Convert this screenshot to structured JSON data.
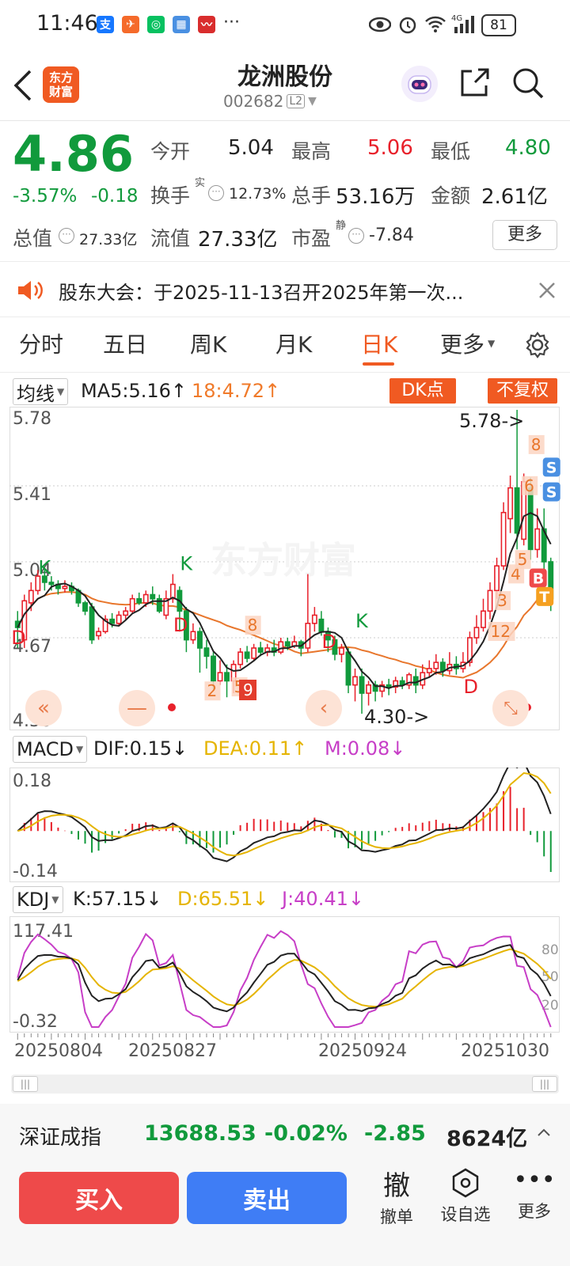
{
  "status": {
    "time": "11:46",
    "battery": "81"
  },
  "header": {
    "logo_line1": "东方",
    "logo_line2": "财富",
    "title": "龙洲股份",
    "code": "002682",
    "level": "L2"
  },
  "quote": {
    "price": "4.86",
    "change_pct": "-3.57%",
    "change": "-0.18",
    "open_label": "今开",
    "open": "5.04",
    "high_label": "最高",
    "high": "5.06",
    "low_label": "最低",
    "low": "4.80",
    "turnover_label": "换手",
    "turnover_sup": "实",
    "turnover": "12.73%",
    "volume_label": "总手",
    "volume": "53.16万",
    "amount_label": "金额",
    "amount": "2.61亿",
    "mktcap_label": "总值",
    "mktcap": "27.33亿",
    "float_label": "流值",
    "float": "27.33亿",
    "pe_label": "市盈",
    "pe_sup": "静",
    "pe": "-7.84",
    "more_label": "更多"
  },
  "notice": {
    "text": "股东大会：于2025-11-13召开2025年第一次..."
  },
  "tabs": [
    {
      "label": "分时"
    },
    {
      "label": "五日"
    },
    {
      "label": "周K"
    },
    {
      "label": "月K"
    },
    {
      "label": "日K",
      "active": true
    },
    {
      "label": "更多"
    }
  ],
  "main_chart": {
    "indicator": "均线",
    "ma5": "MA5:5.16↑",
    "ma18": "18:4.72↑",
    "dk_btn": "DK点",
    "adjust_btn": "不复权",
    "y_labels": [
      "5.78",
      "5.41",
      "5.04",
      "4.67",
      "4.30"
    ],
    "max_annot": "5.78->",
    "min_annot": "4.30->",
    "watermark": "东方财富"
  },
  "macd": {
    "indicator": "MACD",
    "dif": "DIF:0.15↓",
    "dea": "DEA:0.11↑",
    "m": "M:0.08↓",
    "y_top": "0.18",
    "y_bottom": "-0.14"
  },
  "kdj": {
    "indicator": "KDJ",
    "k": "K:57.15↓",
    "d": "D:65.51↓",
    "j": "J:40.41↓",
    "y_top": "117.41",
    "y_bottom": "-0.32",
    "r80": "80",
    "r50": "50",
    "r20": "20"
  },
  "dates": [
    "20250804",
    "20250827",
    "20250924",
    "20251030"
  ],
  "index_bar": {
    "name": "深证成指",
    "value": "13688.53",
    "pct": "-0.02%",
    "change": "-2.85",
    "amount": "8624亿"
  },
  "actions": {
    "buy": "买入",
    "sell": "卖出",
    "cancel_big": "撤",
    "cancel": "撤单",
    "watch": "设自选",
    "more": "更多"
  },
  "colors": {
    "up": "#e8212b",
    "down": "#119a3c",
    "accent": "#f05a22",
    "sell_blue": "#3f7df5"
  },
  "chart_data": {
    "type": "candlestick",
    "ylim": [
      4.3,
      5.78
    ],
    "candles": [
      [
        4.75,
        4.72,
        4.8,
        4.62
      ],
      [
        4.66,
        4.85,
        4.88,
        4.62
      ],
      [
        4.84,
        4.9,
        4.94,
        4.8
      ],
      [
        4.9,
        4.97,
        5.0,
        4.88
      ],
      [
        4.97,
        4.94,
        5.01,
        4.9
      ],
      [
        4.94,
        4.93,
        4.97,
        4.9
      ],
      [
        4.93,
        4.91,
        4.95,
        4.88
      ],
      [
        4.91,
        4.92,
        4.95,
        4.89
      ],
      [
        4.92,
        4.9,
        4.94,
        4.88
      ],
      [
        4.9,
        4.84,
        4.91,
        4.82
      ],
      [
        4.84,
        4.8,
        4.85,
        4.78
      ],
      [
        4.82,
        4.66,
        4.84,
        4.64
      ],
      [
        4.68,
        4.7,
        4.72,
        4.66
      ],
      [
        4.7,
        4.76,
        4.78,
        4.69
      ],
      [
        4.76,
        4.74,
        4.79,
        4.72
      ],
      [
        4.74,
        4.78,
        4.8,
        4.73
      ],
      [
        4.78,
        4.8,
        4.82,
        4.76
      ],
      [
        4.8,
        4.86,
        4.88,
        4.79
      ],
      [
        4.86,
        4.84,
        4.89,
        4.83
      ],
      [
        4.84,
        4.88,
        4.9,
        4.82
      ],
      [
        4.88,
        4.86,
        4.92,
        4.83
      ],
      [
        4.86,
        4.8,
        4.88,
        4.79
      ],
      [
        4.78,
        4.86,
        4.9,
        4.76
      ],
      [
        4.86,
        4.93,
        4.98,
        4.84
      ],
      [
        4.9,
        4.8,
        4.92,
        4.7
      ],
      [
        4.8,
        4.66,
        4.82,
        4.6
      ],
      [
        4.66,
        4.7,
        4.74,
        4.64
      ],
      [
        4.7,
        4.62,
        4.72,
        4.5
      ],
      [
        4.62,
        4.58,
        4.66,
        4.52
      ],
      [
        4.58,
        4.46,
        4.6,
        4.42
      ],
      [
        4.46,
        4.5,
        4.56,
        4.44
      ],
      [
        4.5,
        4.46,
        4.54,
        4.38
      ],
      [
        4.46,
        4.54,
        4.56,
        4.4
      ],
      [
        4.54,
        4.6,
        4.62,
        4.52
      ],
      [
        4.6,
        4.57,
        4.63,
        4.55
      ],
      [
        4.57,
        4.62,
        4.64,
        4.56
      ],
      [
        4.62,
        4.6,
        4.65,
        4.58
      ],
      [
        4.6,
        4.62,
        4.64,
        4.58
      ],
      [
        4.62,
        4.6,
        4.66,
        4.58
      ],
      [
        4.6,
        4.65,
        4.67,
        4.59
      ],
      [
        4.65,
        4.63,
        4.67,
        4.61
      ],
      [
        4.63,
        4.65,
        4.68,
        4.62
      ],
      [
        4.65,
        4.62,
        4.66,
        4.58
      ],
      [
        4.62,
        4.74,
        4.98,
        4.6
      ],
      [
        4.74,
        4.78,
        4.82,
        4.7
      ],
      [
        4.76,
        4.7,
        4.8,
        4.68
      ],
      [
        4.7,
        4.66,
        4.72,
        4.6
      ],
      [
        4.66,
        4.59,
        4.68,
        4.56
      ],
      [
        4.59,
        4.62,
        4.64,
        4.55
      ],
      [
        4.6,
        4.44,
        4.62,
        4.4
      ],
      [
        4.44,
        4.48,
        4.52,
        4.36
      ],
      [
        4.48,
        4.4,
        4.52,
        4.3
      ],
      [
        4.4,
        4.44,
        4.46,
        4.34
      ],
      [
        4.44,
        4.41,
        4.46,
        4.36
      ],
      [
        4.41,
        4.44,
        4.46,
        4.38
      ],
      [
        4.44,
        4.43,
        4.47,
        4.39
      ],
      [
        4.43,
        4.46,
        4.48,
        4.4
      ],
      [
        4.46,
        4.44,
        4.48,
        4.42
      ],
      [
        4.44,
        4.49,
        4.5,
        4.42
      ],
      [
        4.48,
        4.44,
        4.52,
        4.4
      ],
      [
        4.44,
        4.5,
        4.54,
        4.42
      ],
      [
        4.5,
        4.52,
        4.56,
        4.48
      ],
      [
        4.52,
        4.55,
        4.59,
        4.49
      ],
      [
        4.55,
        4.51,
        4.57,
        4.48
      ],
      [
        4.51,
        4.54,
        4.6,
        4.49
      ],
      [
        4.54,
        4.52,
        4.58,
        4.49
      ],
      [
        4.52,
        4.55,
        4.6,
        4.5
      ],
      [
        4.55,
        4.67,
        4.7,
        4.53
      ],
      [
        4.67,
        4.72,
        4.78,
        4.64
      ],
      [
        4.72,
        4.8,
        4.86,
        4.7
      ],
      [
        4.8,
        4.9,
        4.94,
        4.76
      ],
      [
        4.9,
        5.02,
        5.06,
        4.86
      ],
      [
        5.02,
        5.28,
        5.33,
        5.0
      ],
      [
        5.25,
        5.4,
        5.46,
        5.18
      ],
      [
        5.4,
        5.18,
        5.78,
        5.1
      ],
      [
        5.15,
        5.43,
        5.47,
        5.12
      ],
      [
        5.4,
        5.1,
        5.45,
        5.05
      ],
      [
        5.1,
        5.2,
        5.3,
        5.06
      ],
      [
        5.2,
        5.04,
        5.3,
        5.0
      ],
      [
        5.04,
        4.86,
        5.06,
        4.8
      ]
    ]
  }
}
